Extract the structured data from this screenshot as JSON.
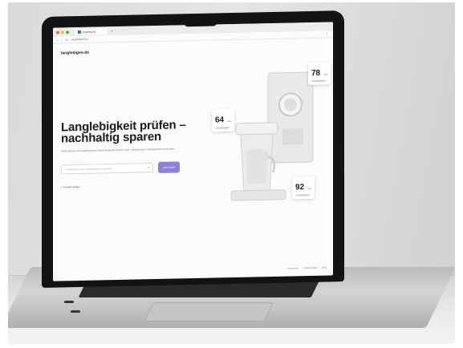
{
  "browser": {
    "tab_title": "langlebig.eu",
    "new_tab": "+",
    "url": "langlebigkeit.de",
    "nav_back": "‹",
    "nav_forward": "›",
    "nav_reload": "⟳",
    "menu": "⋮"
  },
  "site": {
    "brand": "langlebigen.de",
    "hero_title": "Langlebigkeit prüfen – nachhaltig sparen",
    "subtitle": "Finde heraus, wie langlebig deine Haushaltsgeräte wirklich sind – Bewertungen, Reparierbarkeit und mehr.",
    "search_placeholder": "Produktname oder Modellnummer eingeben",
    "button_label": "Jetzt prüfen",
    "secondary_link": "+ Produkt melden",
    "footer": [
      "Impressum",
      "Datenschutz",
      "FAQ"
    ]
  },
  "badges": [
    {
      "value": "78",
      "unit": "von",
      "label": "Langlebigkeit"
    },
    {
      "value": "64",
      "unit": "von",
      "label": "Langlebigkeit"
    },
    {
      "value": "92",
      "unit": "von",
      "label": "Langlebigkeit"
    }
  ],
  "colors": {
    "accent": "#8a82d6",
    "text": "#1b1b1d",
    "background": "#fbfbfc"
  }
}
